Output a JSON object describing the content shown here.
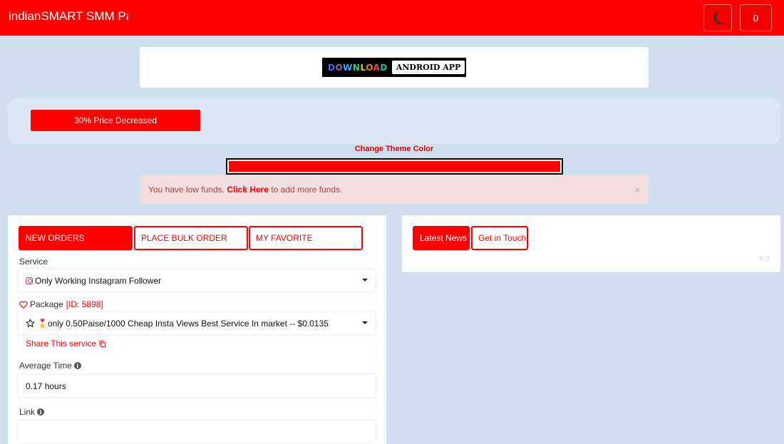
{
  "header": {
    "brand": "indianSMART SMM Panel",
    "theme_toggle_icon": "moon-icon",
    "balance": "0",
    "bar_color": "#ff0000"
  },
  "banner": {
    "word1": "DOWNLOAD",
    "word2": "ANDROID APP"
  },
  "promo": {
    "button": "30% Price Decreased"
  },
  "theme": {
    "label": "Change Theme Color",
    "selected_color": "#ff0000"
  },
  "alert": {
    "text": "You have low funds.",
    "link": "Click Here",
    "suffix": "to add more funds.",
    "close": "×"
  },
  "order_tabs": [
    {
      "label": "NEW ORDERS",
      "active": true
    },
    {
      "label": "PLACE BULK ORDER",
      "active": false
    },
    {
      "label": "MY FAVORITE",
      "active": false
    }
  ],
  "form": {
    "service_label": "Service",
    "service_value": "Only Working Instagram Follower",
    "package_label": "Package",
    "package_id": "[ID: 5898]",
    "package_value": "🎖️only 0.50Paise/1000 Cheap Insta Views Best Service In market -- $0.0135",
    "share": "Share This service",
    "avg_time_label": "Average Time",
    "avg_time_value": "0.17 hours",
    "link_label": "Link",
    "link_value": ""
  },
  "news_tabs": [
    {
      "label": "Latest News",
      "active": true
    },
    {
      "label": "Get in Touch",
      "active": false
    }
  ]
}
